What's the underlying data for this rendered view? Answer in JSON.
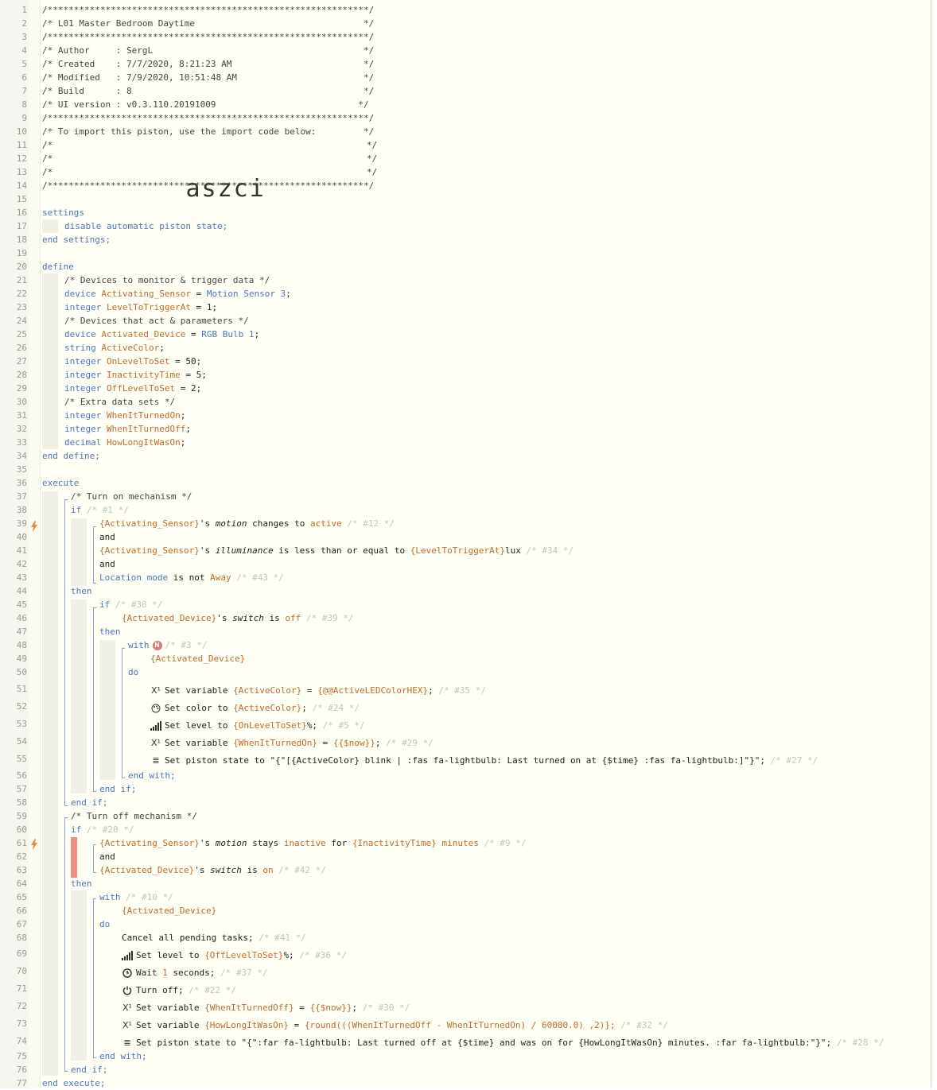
{
  "lines": [
    "1",
    "2",
    "3",
    "4",
    "5",
    "6",
    "7",
    "8",
    "9",
    "10",
    "11",
    "12",
    "13",
    "14",
    "15",
    "16",
    "17",
    "18",
    "19",
    "20",
    "21",
    "22",
    "23",
    "24",
    "25",
    "26",
    "27",
    "28",
    "29",
    "30",
    "31",
    "32",
    "33",
    "34",
    "35",
    "36",
    "37",
    "38",
    "39",
    "40",
    "41",
    "42",
    "43",
    "44",
    "45",
    "46",
    "47",
    "48",
    "49",
    "50",
    "51",
    "52",
    "53",
    "54",
    "55",
    "56",
    "57",
    "58",
    "59",
    "60",
    "61",
    "62",
    "63",
    "64",
    "65",
    "66",
    "67",
    "68",
    "69",
    "70",
    "71",
    "72",
    "73",
    "74",
    "75",
    "76",
    "77"
  ],
  "header": {
    "stars": "/*************************************************************/",
    "title": "/* L01 Master Bedroom Daytime                                */",
    "author": "/* Author     : SergL                                        */",
    "created": "/* Created    : 7/7/2020, 8:21:23 AM                         */",
    "modified": "/* Modified   : 7/9/2020, 10:51:48 AM                        */",
    "build": "/* Build      : 8                                            */",
    "ui_version": "/* UI version : v0.3.110.20191009                           */",
    "import_note": "/* To import this piston, use the import code below:         */",
    "blank_left": "/*",
    "blank_right": "*/",
    "import_code": "aszci"
  },
  "settings": {
    "open": "settings",
    "disable": "disable automatic piston state;",
    "close": "end settings;"
  },
  "define": {
    "open": "define",
    "c1": "/* Devices to monitor & trigger data */",
    "c2": "/* Devices that act & parameters */",
    "c3": "/* Extra data sets */",
    "close": "end define;",
    "vars": {
      "device": "device",
      "integer": "integer",
      "string": "string",
      "decimal": "decimal",
      "activating_sensor": "Activating_Sensor",
      "motion_sensor": "Motion Sensor 3",
      "level_to_trigger": "LevelToTriggerAt",
      "one": "1",
      "activated_device": "Activated_Device",
      "rgb_bulb": "RGB Bulb 1",
      "active_color": "ActiveColor",
      "on_level": "OnLevelToSet",
      "fifty": "50",
      "inactivity": "InactivityTime",
      "five": "5",
      "off_level": "OffLevelToSet",
      "two": "2",
      "when_on": "WhenItTurnedOn",
      "when_off": "WhenItTurnedOff",
      "how_long": "HowLongItWasOn"
    }
  },
  "execute": {
    "open": "execute",
    "close": "end execute;",
    "turn_on_comment": "/* Turn on mechanism */",
    "turn_off_comment": "/* Turn off mechanism */",
    "if": "if",
    "then": "then",
    "and": "and",
    "with": "with",
    "do": "do",
    "end_if": "end if;",
    "end_with": "end with;",
    "c_1": "/* #1 */",
    "c_12": "/* #12 */",
    "c_34": "/* #34 */",
    "c_43": "/* #43 */",
    "c_38": "/* #38 */",
    "c_39": "/* #39 */",
    "c_3": "/* #3 */",
    "c_35": "/* #35 */",
    "c_24": "/* #24 */",
    "c_5": "/* #5 */",
    "c_29": "/* #29 */",
    "c_27": "/* #27 */",
    "c_20": "/* #20 */",
    "c_9": "/* #9 */",
    "c_42": "/* #42 */",
    "c_10": "/* #10 */",
    "c_41": "/* #41 */",
    "c_36": "/* #36 */",
    "c_37": "/* #37 */",
    "c_22": "/* #22 */",
    "c_30": "/* #30 */",
    "c_32": "/* #32 */",
    "c_28": "/* #28 */",
    "sensor_ref": "{Activating_Sensor}",
    "device_ref": "{Activated_Device}",
    "s_possessive": "'s ",
    "motion": "motion",
    "illuminance": "illuminance",
    "switch": "switch",
    "changes_to": " changes to ",
    "active": "active",
    "less_eq": " is less than or equal to ",
    "level_ref": "{LevelToTriggerAt}",
    "lux": "lux",
    "location_mode": "Location mode",
    "is_not": " is not ",
    "away": "Away",
    "is_txt": " is ",
    "off": "off",
    "on": "on",
    "stays": " stays ",
    "inactive": "inactive",
    "for_txt": " for ",
    "inactivity_ref": "{InactivityTime}",
    "minutes": " minutes",
    "n_badge": "N",
    "set_variable": "Set variable ",
    "active_color_ref": "{ActiveColor}",
    "eq": " = ",
    "led_hex": "{@@ActiveLEDColorHEX}",
    "semi": ";",
    "set_color": "Set color to ",
    "set_level": "Set level to ",
    "on_level_ref": "{OnLevelToSet}",
    "pct": "%;",
    "when_on_ref": "{WhenItTurnedOn}",
    "now": "{{$now}}",
    "set_state": "Set piston state to ",
    "state_on": "\"{\"[{ActiveColor} blink | :fas fa-lightbulb: Last turned on at {$time} :fas fa-lightbulb:]\"}\";",
    "cancel": "Cancel all pending tasks;",
    "off_level_ref": "{OffLevelToSet}",
    "wait": "Wait ",
    "one": "1",
    "seconds": " seconds;",
    "turn_off": "Turn off;",
    "when_off_ref": "{WhenItTurnedOff}",
    "how_long_ref": "{HowLongItWasOn}",
    "round_expr": "{round(((WhenItTurnedOff - WhenItTurnedOn) / 60000.0) ,2)};",
    "state_off": "\"{\":far fa-lightbulb: Last turned off at {$time} and was on for {HowLongItWasOn} minutes. :far fa-lightbulb:\"}\";"
  },
  "icons": [
    "lightning-icon",
    "variable-icon",
    "palette-icon",
    "signal-bars-icon",
    "list-icon",
    "clock-icon",
    "power-icon"
  ],
  "colors": {
    "keyword": "#4a76b8",
    "variable": "#c06a2c",
    "comment_faded": "#c3c3b8",
    "error_bar": "#f08c80",
    "background": "#fffff5"
  }
}
